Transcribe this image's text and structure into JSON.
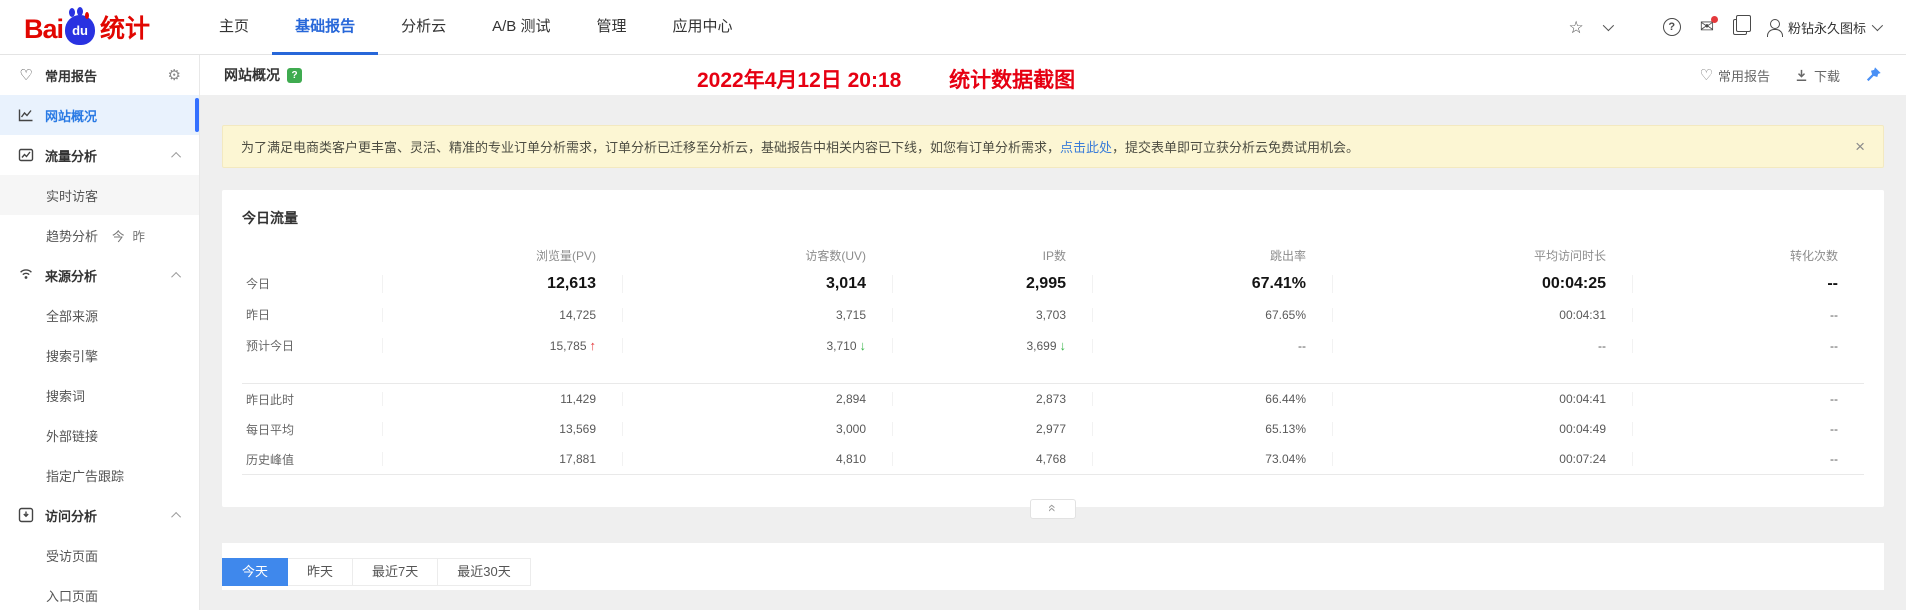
{
  "navbar": {
    "logo": {
      "bai": "Bai",
      "du": "du",
      "suffix": "统计"
    },
    "items": [
      {
        "label": "主页",
        "active": false
      },
      {
        "label": "基础报告",
        "active": true
      },
      {
        "label": "分析云",
        "active": false
      },
      {
        "label": "A/B 测试",
        "active": false
      },
      {
        "label": "管理",
        "active": false
      },
      {
        "label": "应用中心",
        "active": false
      }
    ],
    "user_label": "粉钻永久图标"
  },
  "icons": {
    "star": "☆",
    "heart": "♡",
    "gear": "⚙",
    "mail": "✉",
    "help": "?",
    "close": "×"
  },
  "sidebar": {
    "fav_label": "常用报告",
    "overview_label": "网站概况",
    "traffic_label": "流量分析",
    "realtime_label": "实时访客",
    "trend_label": "趋势分析",
    "trend_today": "今",
    "trend_yesterday": "昨",
    "source_label": "来源分析",
    "all_sources_label": "全部来源",
    "search_engine_label": "搜索引擎",
    "search_terms_label": "搜索词",
    "external_links_label": "外部链接",
    "ad_tracking_label": "指定广告跟踪",
    "visit_label": "访问分析",
    "visited_pages_label": "受访页面",
    "entry_pages_label": "入口页面"
  },
  "content": {
    "page_title": "网站概况",
    "overlay": {
      "datetime": "2022年4月12日 20:18",
      "caption": "统计数据截图"
    },
    "actions": {
      "favorite": "常用报告",
      "download": "下载"
    },
    "banner": {
      "text": "为了满足电商类客户更丰富、灵活、精准的专业订单分析需求，订单分析已迁移至分析云，基础报告中相关内容已下线，如您有订单分析需求，",
      "link": "点击此处",
      "text_after": "，提交表单即可立获分析云免费试用机会。"
    },
    "table": {
      "title": "今日流量",
      "columns": [
        "浏览量(PV)",
        "访客数(UV)",
        "IP数",
        "跳出率",
        "平均访问时长",
        "转化次数"
      ],
      "groups": [
        {
          "rows": [
            {
              "label": "今日",
              "values": [
                "12,613",
                "3,014",
                "2,995",
                "67.41%",
                "00:04:25",
                "--"
              ]
            },
            {
              "label": "昨日",
              "values": [
                "14,725",
                "3,715",
                "3,703",
                "67.65%",
                "00:04:31",
                "--"
              ]
            },
            {
              "label": "预计今日",
              "values": [
                "15,785",
                "3,710",
                "3,699",
                "--",
                "--",
                "--"
              ],
              "trends": [
                "up",
                "down",
                "down",
                "",
                "",
                ""
              ]
            }
          ]
        },
        {
          "rows": [
            {
              "label": "昨日此时",
              "values": [
                "11,429",
                "2,894",
                "2,873",
                "66.44%",
                "00:04:41",
                "--"
              ]
            },
            {
              "label": "每日平均",
              "values": [
                "13,569",
                "3,000",
                "2,977",
                "65.13%",
                "00:04:49",
                "--"
              ]
            },
            {
              "label": "历史峰值",
              "values": [
                "17,881",
                "4,810",
                "4,768",
                "73.04%",
                "00:07:24",
                "--"
              ]
            }
          ]
        }
      ]
    },
    "date_tabs": [
      {
        "label": "今天",
        "active": true
      },
      {
        "label": "昨天",
        "active": false
      },
      {
        "label": "最近7天",
        "active": false
      },
      {
        "label": "最近30天",
        "active": false
      }
    ]
  },
  "colors": {
    "accent_blue": "#2a7ae4",
    "active_tab_blue": "#3f88ec",
    "trend_up_red": "#e4393c",
    "trend_down_green": "#39b54a",
    "overlay_red": "#e60012",
    "banner_bg": "#fcf6d3",
    "logo_red": "#e10601"
  }
}
